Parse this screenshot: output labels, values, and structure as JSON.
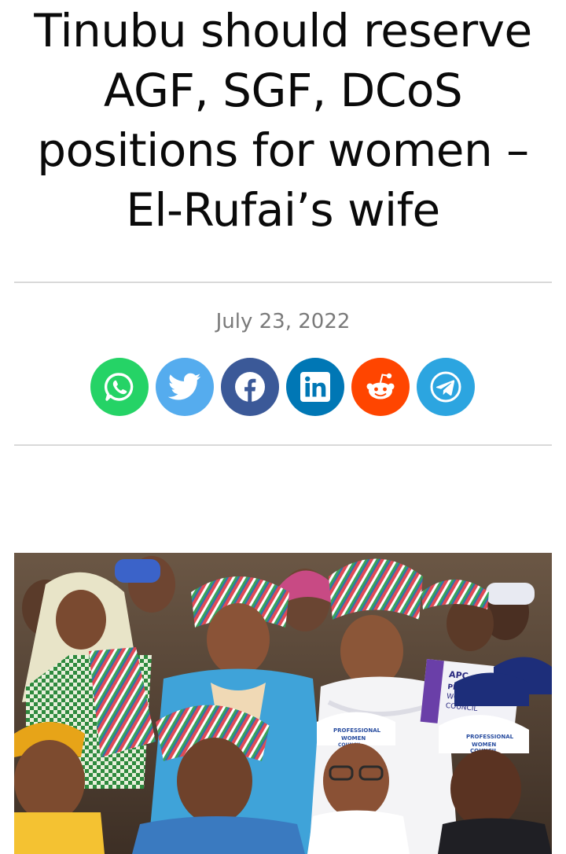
{
  "article": {
    "headline": "Tinubu should reserve AGF, SGF, DCoS positions for women – El-Rufai’s wife",
    "date": "July 23, 2022"
  },
  "share": [
    {
      "name": "whatsapp",
      "icon": "whatsapp-icon",
      "color": "#25d366"
    },
    {
      "name": "twitter",
      "icon": "twitter-icon",
      "color": "#55acee"
    },
    {
      "name": "facebook",
      "icon": "facebook-icon",
      "color": "#3b5998"
    },
    {
      "name": "linkedin",
      "icon": "linkedin-icon",
      "color": "#0077b5"
    },
    {
      "name": "reddit",
      "icon": "reddit-icon",
      "color": "#ff4500"
    },
    {
      "name": "telegram",
      "icon": "telegram-icon",
      "color": "#2ca5e0"
    }
  ],
  "photo": {
    "caps_text": [
      "PROFESSIONAL",
      "WOMEN",
      "COUNCIL"
    ],
    "poster_text": [
      "APC",
      "PROFESSIONAL",
      "WOMEN",
      "COUNCIL"
    ]
  }
}
